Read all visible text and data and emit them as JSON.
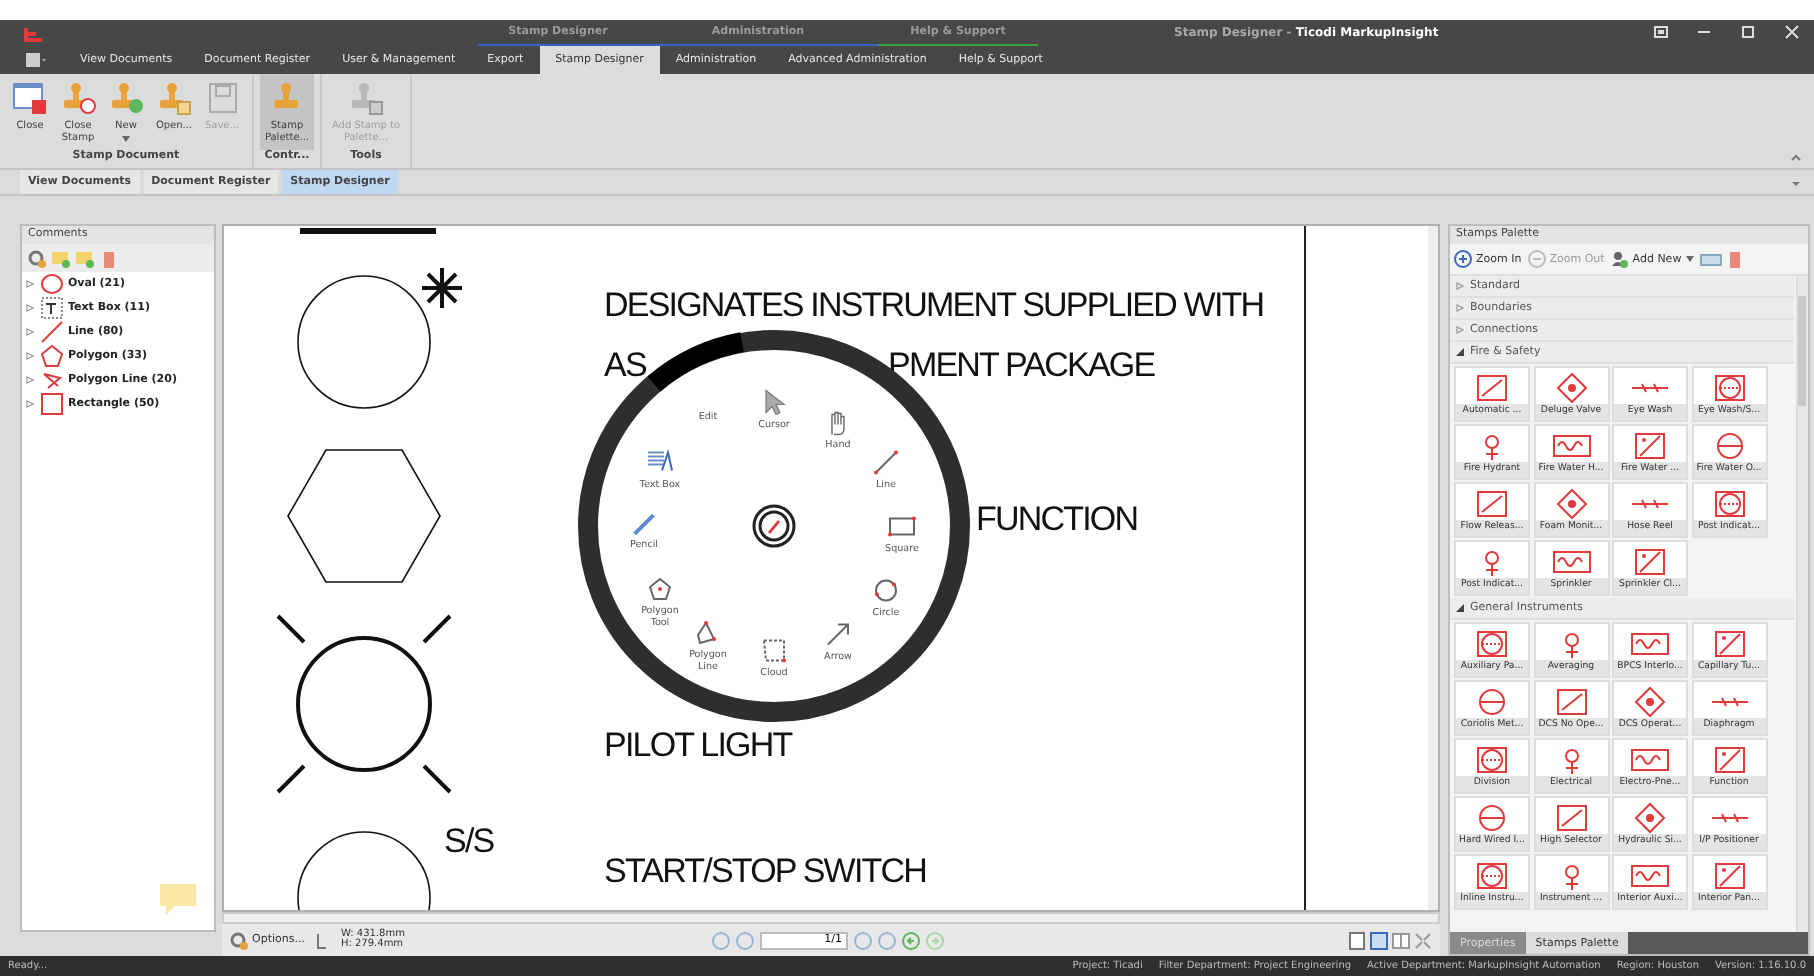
{
  "title_bar": {
    "context_groups": [
      {
        "label": "Stamp Designer",
        "color": "#3b5fd0"
      },
      {
        "label": "Administration",
        "color": "#3b5fd0"
      },
      {
        "label": "Help & Support",
        "color": "#3aa03a"
      }
    ],
    "title": "Stamp Designer - **Ticodi MarkupInsight**"
  },
  "ribbon_tabs": [
    {
      "label": "View Documents",
      "selected": false
    },
    {
      "label": "Document Register",
      "selected": false
    },
    {
      "label": "User & Management",
      "selected": false
    },
    {
      "label": "Export",
      "selected": false
    },
    {
      "label": "Stamp Designer",
      "selected": true
    },
    {
      "label": "Administration",
      "selected": false
    },
    {
      "label": "Advanced Administration",
      "selected": false
    },
    {
      "label": "Help & Support",
      "selected": false
    }
  ],
  "ribbon_groups": [
    {
      "label": "Stamp Document",
      "buttons": [
        {
          "label": "Close",
          "disabled": false,
          "pressed": false,
          "dropdown": false
        },
        {
          "label": "Close Stamp",
          "disabled": false,
          "pressed": false,
          "dropdown": false
        },
        {
          "label": "New",
          "disabled": false,
          "pressed": false,
          "dropdown": true
        },
        {
          "label": "Open...",
          "disabled": false,
          "pressed": false,
          "dropdown": false
        },
        {
          "label": "Save...",
          "disabled": true,
          "pressed": false,
          "dropdown": false
        }
      ]
    },
    {
      "label": "Contr...",
      "buttons": [
        {
          "label": "Stamp Palette...",
          "disabled": false,
          "pressed": true,
          "dropdown": false
        }
      ]
    },
    {
      "label": "Tools",
      "buttons": [
        {
          "label": "Add Stamp to Palette...",
          "disabled": true,
          "pressed": false,
          "dropdown": false
        }
      ]
    }
  ],
  "document_tabs": [
    {
      "label": "View Documents",
      "selected": false
    },
    {
      "label": "Document Register",
      "selected": false
    },
    {
      "label": "Stamp Designer",
      "selected": true
    }
  ],
  "comments_panel": {
    "title": "Comments",
    "items": [
      {
        "label": "Oval (21)",
        "expanded": false
      },
      {
        "label": "Text Box (11)",
        "expanded": false
      },
      {
        "label": "Line (80)",
        "expanded": false
      },
      {
        "label": "Polygon (33)",
        "expanded": false
      },
      {
        "label": "Polygon Line (20)",
        "expanded": false
      },
      {
        "label": "Rectangle (50)",
        "expanded": false
      }
    ]
  },
  "canvas": {
    "texts": [
      "DESIGNATES INSTRUMENT SUPPLIED WITH",
      "AS",
      "PMENT PACKAGE",
      "FUNCTION",
      "PILOT LIGHT",
      "S/S",
      "START/STOP SWITCH"
    ]
  },
  "radial_menu": {
    "items": [
      "Edit",
      "Cursor",
      "Hand",
      "Text Box",
      "Line",
      "Pencil",
      "Square",
      "Polygon Tool",
      "Circle",
      "Polygon Line",
      "Arrow",
      "Cloud"
    ]
  },
  "bottom_toolbar": {
    "options": "Options...",
    "width": "W: 431.8mm",
    "height": "H: 279.4mm",
    "page": "1/1"
  },
  "stamps_palette": {
    "title": "Stamps Palette",
    "toolbar": [
      {
        "label": "Zoom In",
        "disabled": false,
        "dropdown": false
      },
      {
        "label": "Zoom Out",
        "disabled": true,
        "dropdown": false
      },
      {
        "label": "Add New",
        "disabled": false,
        "dropdown": true
      }
    ],
    "categories": [
      {
        "label": "Standard",
        "expanded": false
      },
      {
        "label": "Boundaries",
        "expanded": false
      },
      {
        "label": "Connections",
        "expanded": false
      },
      {
        "label": "Fire & Safety",
        "expanded": true,
        "items": [
          "Automatic ...",
          "Deluge Valve",
          "Eye Wash",
          "Eye Wash/S...",
          "Fire Hydrant",
          "Fire Water H...",
          "Fire Water ...",
          "Fire Water O...",
          "Flow Releas...",
          "Foam Monit...",
          "Hose Reel",
          "Post Indicat...",
          "Post Indicat...",
          "Sprinkler",
          "Sprinkler Cl..."
        ]
      },
      {
        "label": "General Instruments",
        "expanded": true,
        "items": [
          "Auxiliary Pa...",
          "Averaging",
          "BPCS Interlo...",
          "Capillary Tu...",
          "Coriolis Met...",
          "DCS No Ope...",
          "DCS Operat...",
          "Diaphragm",
          "Division",
          "Electrical",
          "Electro-Pne...",
          "Function",
          "Hard Wired I...",
          "High Selector",
          "Hydraulic Si...",
          "I/P Positioner",
          "Inline Instru...",
          "Instrument ...",
          "Interior Auxi...",
          "Interior Pan..."
        ]
      }
    ]
  },
  "panel_tabs": [
    {
      "label": "Properties",
      "selected": false
    },
    {
      "label": "Stamps Palette",
      "selected": true
    }
  ],
  "status_bar": {
    "left": "Ready...",
    "fields": [
      "Project: Ticadi",
      "Filter Department: Project Engineering",
      "Active Department: MarkupInsight Automation",
      "Region: Houston",
      "Version: 1.16.10.0"
    ]
  }
}
